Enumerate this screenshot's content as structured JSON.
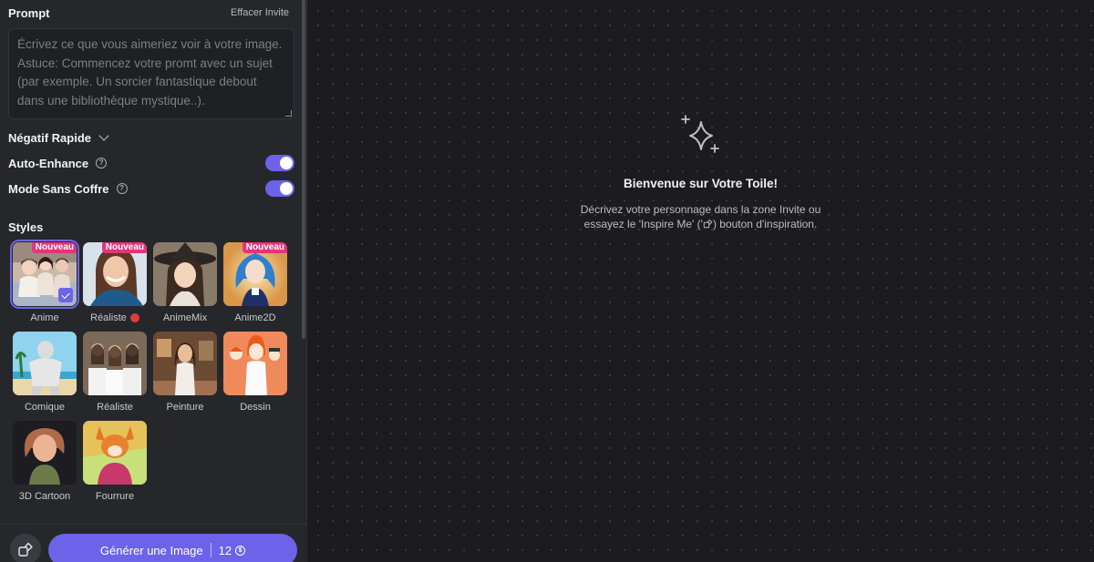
{
  "prompt": {
    "title": "Prompt",
    "clear_label": "Effacer Invite",
    "placeholder": "Écrivez ce que vous aimeriez voir à votre image. Astuce: Commencez votre promt avec un sujet (par exemple. Un sorcier fantastique debout dans une bibliothèque mystique..).",
    "value": ""
  },
  "options": {
    "negative_label": "Négatif Rapide",
    "auto_enhance_label": "Auto-Enhance",
    "auto_enhance_on": true,
    "safe_mode_label": "Mode Sans Coffre",
    "safe_mode_on": true
  },
  "styles": {
    "title": "Styles",
    "badge_label": "Nouveau",
    "items": [
      {
        "label": "Anime",
        "badge": true,
        "selected": true
      },
      {
        "label": "Réaliste",
        "badge": true,
        "selected": false
      },
      {
        "label": "AnimeMix",
        "badge": false,
        "selected": false
      },
      {
        "label": "Anime2D",
        "badge": true,
        "selected": false
      },
      {
        "label": "Comique",
        "badge": false,
        "selected": false
      },
      {
        "label": "Réaliste",
        "badge": false,
        "selected": false
      },
      {
        "label": "Peinture",
        "badge": false,
        "selected": false
      },
      {
        "label": "Dessin",
        "badge": false,
        "selected": false
      },
      {
        "label": "3D Cartoon",
        "badge": false,
        "selected": false
      },
      {
        "label": "Fourrure",
        "badge": false,
        "selected": false
      }
    ]
  },
  "footer": {
    "generate_label": "Générer une Image",
    "cost": "12",
    "coin_symbol": "$",
    "inspire_icon": "inspire-icon"
  },
  "canvas": {
    "title": "Bienvenue sur Votre Toile!",
    "line1": "Décrivez votre personnage dans la zone Invite ou",
    "line2_start": "essayez le 'Inspire Me' (",
    "line2_end": ") bouton d'inspiration.",
    "quote_char": "'"
  },
  "colors": {
    "accent": "#6c63e8",
    "badge": "#e3357a",
    "sidebar_bg": "#26272b",
    "canvas_bg": "#1c1c1f"
  }
}
